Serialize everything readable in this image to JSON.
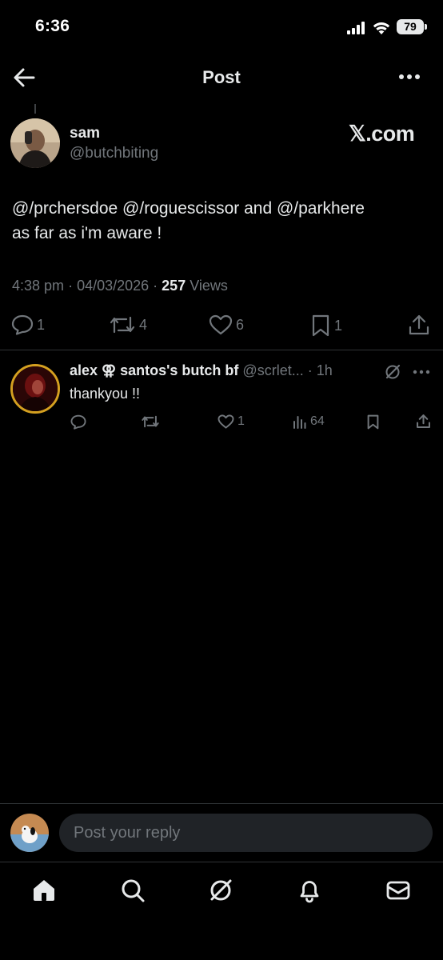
{
  "status_bar": {
    "time": "6:36",
    "battery": "79"
  },
  "header": {
    "title": "Post"
  },
  "post": {
    "author_name": "sam",
    "author_handle": "@butchbiting",
    "watermark": "𝕏.com",
    "text_line1": "@/prchersdoe @/roguescissor and @/parkhere",
    "text_line2": "as far as i'm aware !",
    "time": "4:38 pm",
    "date": "04/03/2026",
    "views_count": "257",
    "views_label": "Views",
    "actions": {
      "replies": "1",
      "reposts": "4",
      "likes": "6",
      "bookmarks": "1"
    }
  },
  "reply": {
    "name": "alex ⚢ santos's butch bf",
    "handle": "@scrlet...",
    "time": "1h",
    "text": "thankyou !!",
    "actions": {
      "replies": "",
      "reposts": "",
      "likes": "1",
      "views": "64"
    }
  },
  "composer": {
    "placeholder": "Post your reply"
  },
  "icons": {
    "back": "arrow-left-icon",
    "more": "more-horizontal-icon",
    "reply": "comment-icon",
    "repost": "repost-icon",
    "like": "heart-icon",
    "bookmark": "bookmark-icon",
    "share": "share-icon",
    "grok": "grok-icon",
    "home": "home-icon",
    "search": "search-icon",
    "notifications": "bell-icon",
    "messages": "mail-icon"
  },
  "colors": {
    "background": "#000000",
    "text": "#e7e9ea",
    "secondary": "#71767b",
    "divider": "#2f3336"
  }
}
